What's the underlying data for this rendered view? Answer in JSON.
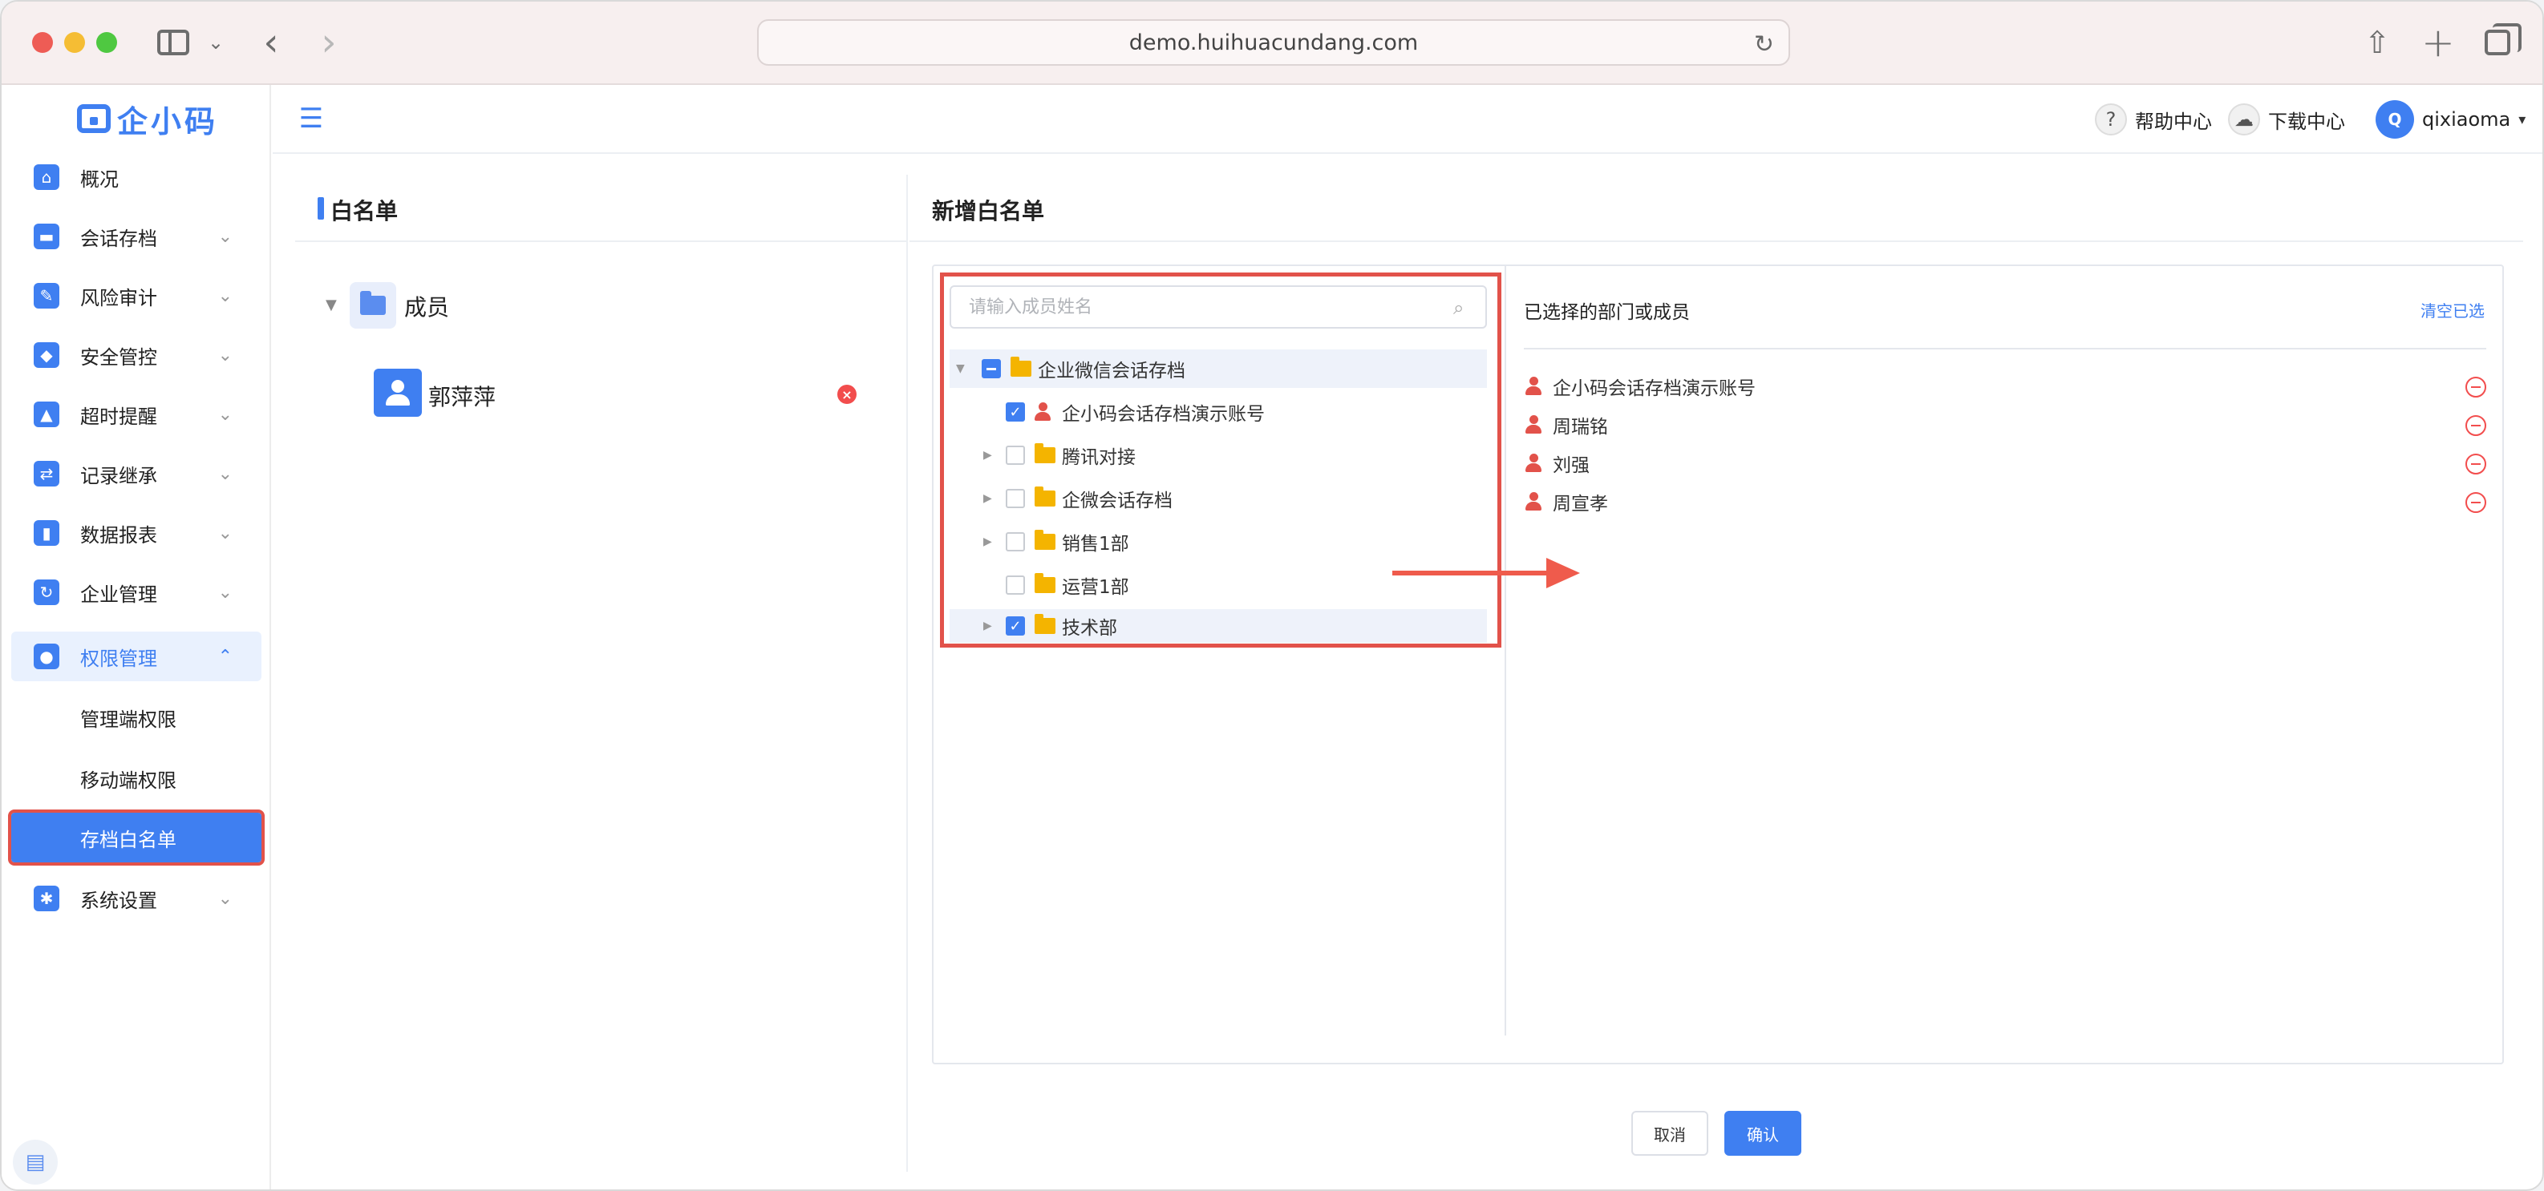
{
  "browser": {
    "url": "demo.huihuacundang.com"
  },
  "brand": {
    "logo_text": "企小码",
    "accent_color": "#3f7ff1",
    "highlight_color": "#e2524a"
  },
  "sidebar": {
    "items": [
      {
        "label": "概况",
        "icon": "home-icon"
      },
      {
        "label": "会话存档",
        "icon": "folder-icon"
      },
      {
        "label": "风险审计",
        "icon": "edit-icon"
      },
      {
        "label": "安全管控",
        "icon": "shield-icon"
      },
      {
        "label": "超时提醒",
        "icon": "bell-icon"
      },
      {
        "label": "记录继承",
        "icon": "transfer-icon"
      },
      {
        "label": "数据报表",
        "icon": "chart-icon"
      },
      {
        "label": "企业管理",
        "icon": "sync-icon"
      },
      {
        "label": "权限管理",
        "icon": "lock-icon"
      },
      {
        "label": "系统设置",
        "icon": "gear-icon"
      }
    ],
    "sub_items": [
      {
        "label": "管理端权限"
      },
      {
        "label": "移动端权限"
      },
      {
        "label": "存档白名单"
      }
    ]
  },
  "header": {
    "help_label": "帮助中心",
    "download_label": "下载中心",
    "user_initial": "Q",
    "user_name": "qixiaoma"
  },
  "whitelist_panel": {
    "title": "白名单",
    "group_label": "成员",
    "member_name": "郭萍萍"
  },
  "add_panel": {
    "title": "新增白名单",
    "search_placeholder": "请输入成员姓名",
    "tree": [
      {
        "label": "企业微信会话存档",
        "type": "folder",
        "state": "partial",
        "level": 0,
        "expandable": true,
        "expanded": true
      },
      {
        "label": "企小码会话存档演示账号",
        "type": "person",
        "state": "checked",
        "level": 1,
        "expandable": false
      },
      {
        "label": "腾讯对接",
        "type": "folder",
        "state": "unchecked",
        "level": 1,
        "expandable": true
      },
      {
        "label": "企微会话存档",
        "type": "folder",
        "state": "unchecked",
        "level": 1,
        "expandable": true
      },
      {
        "label": "销售1部",
        "type": "folder",
        "state": "unchecked",
        "level": 1,
        "expandable": true
      },
      {
        "label": "运营1部",
        "type": "folder",
        "state": "unchecked",
        "level": 1,
        "expandable": false
      },
      {
        "label": "技术部",
        "type": "folder",
        "state": "checked",
        "level": 1,
        "expandable": true
      }
    ],
    "selected_title": "已选择的部门或成员",
    "clear_label": "清空已选",
    "selected": [
      {
        "name": "企小码会话存档演示账号"
      },
      {
        "name": "周瑞铭"
      },
      {
        "name": "刘强"
      },
      {
        "name": "周宣孝"
      }
    ],
    "cancel_label": "取消",
    "confirm_label": "确认"
  }
}
